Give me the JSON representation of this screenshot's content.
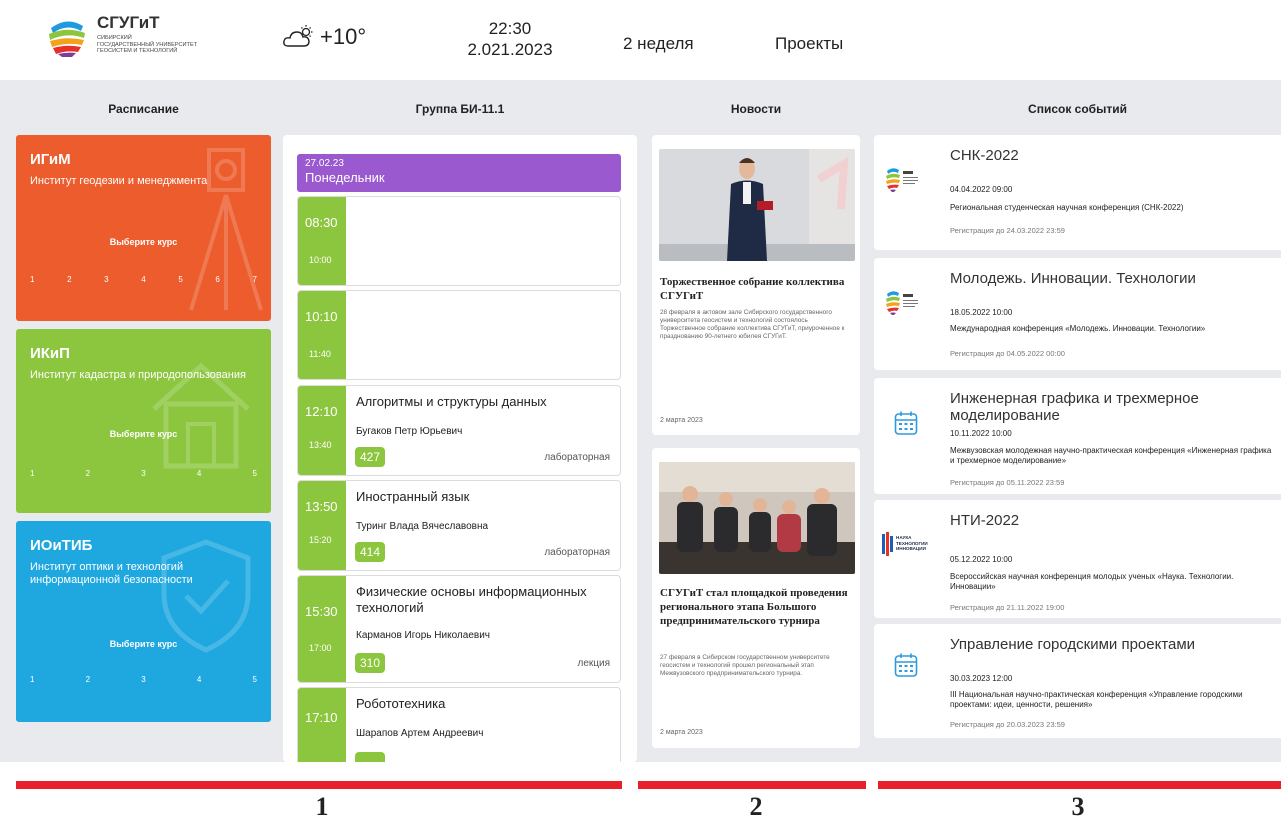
{
  "header": {
    "logo_name": "СГУГиТ",
    "logo_subtitle": "СИБИРСКИЙ\nГОСУДАРСТВЕННЫЙ УНИВЕРСИТЕТ\nГЕОСИСТЕМ И ТЕХНОЛОГИЙ",
    "weather_icon": "cloud-sun-icon",
    "temperature": "+10°",
    "time": "22:30",
    "date": "2.021.2023",
    "week": "2 неделя",
    "projects": "Проекты"
  },
  "columns": {
    "schedule": "Расписание",
    "group": "Группа БИ-11.1",
    "news": "Новости",
    "events": "Список событий"
  },
  "institutes": [
    {
      "abbr": "ИГиМ",
      "name": "Институт геодезии и менеджмента",
      "pick_label": "Выберите курс",
      "courses": [
        "1",
        "2",
        "3",
        "4",
        "5",
        "6",
        "7"
      ],
      "color": "#ec5c2d",
      "icon": "theodolite-icon"
    },
    {
      "abbr": "ИКиП",
      "name": "Институт кадастра и природопользования",
      "pick_label": "Выберите курс",
      "courses": [
        "1",
        "2",
        "3",
        "4",
        "5"
      ],
      "color": "#8cc63f",
      "icon": "house-icon"
    },
    {
      "abbr": "ИОиТИБ",
      "name": "Институт оптики и технологий информационной безопасности",
      "pick_label": "Выберите курс",
      "courses": [
        "1",
        "2",
        "3",
        "4",
        "5"
      ],
      "color": "#1fa8e0",
      "icon": "shield-icon"
    }
  ],
  "schedule": {
    "day_date": "27.02.23",
    "day_name": "Понедельник",
    "day_color": "#9b59d0",
    "slots": [
      {
        "start": "08:30",
        "end": "10:00",
        "subject": "",
        "teacher": "",
        "room": "",
        "kind": ""
      },
      {
        "start": "10:10",
        "end": "11:40",
        "subject": "",
        "teacher": "",
        "room": "",
        "kind": ""
      },
      {
        "start": "12:10",
        "end": "13:40",
        "subject": "Алгоритмы и структуры данных",
        "teacher": "Бугаков Петр Юрьевич",
        "room": "427",
        "kind": "лабораторная"
      },
      {
        "start": "13:50",
        "end": "15:20",
        "subject": "Иностранный язык",
        "teacher": "Туринг Влада Вячеславовна",
        "room": "414",
        "kind": "лабораторная"
      },
      {
        "start": "15:30",
        "end": "17:00",
        "subject": "Физические основы информационных технологий",
        "teacher": "Карманов Игорь Николаевич",
        "room": "310",
        "kind": "лекция"
      },
      {
        "start": "17:10",
        "end": "",
        "subject": "Робототехника",
        "teacher": "Шарапов Артем Андреевич",
        "room": "",
        "kind": ""
      }
    ]
  },
  "news": [
    {
      "title": "Торжественное собрание коллектива СГУГиТ",
      "text": "28 февраля в актовом зале Сибирского государственного университета геосистем и технологий состоялось Торжественное собрание коллектива СГУГиТ, приуроченное к празднованию 90-летнего юбилея СГУГиТ.",
      "date": "2 марта 2023"
    },
    {
      "title": "СГУГиТ стал площадкой проведения регионального этапа Большого предпринимательского турнира",
      "text": "27 февраля в Сибирском государственном университете геосистем и технологий прошел региональный этап Межвузовского предпринимательского турнира.",
      "date": "2 марта 2023"
    }
  ],
  "events": [
    {
      "icon": "sgugit-logo-icon",
      "name": "СНК-2022",
      "datetime": "04.04.2022 09:00",
      "description": "Региональная студенческая научная конференция (СНК-2022)",
      "registration": "Регистрация до 24.03.2022 23:59"
    },
    {
      "icon": "sgugit-logo-icon",
      "name": "Молодежь. Инновации. Технологии",
      "datetime": "18.05.2022 10:00",
      "description": "Международная конференция «Молодежь. Инновации. Технологии»",
      "registration": "Регистрация до 04.05.2022 00:00"
    },
    {
      "icon": "calendar-icon",
      "name": "Инженерная графика и трехмерное моделирование",
      "datetime": "10.11.2022 10:00",
      "description": "Межвузовская молодежная научно-практическая конференция «Инженерная графика и трехмерное моделирование»",
      "registration": "Регистрация до 05.11.2022 23:59"
    },
    {
      "icon": "nti-logo-icon",
      "logo_text": "НАУКА ТЕХНОЛОГИИ ИННОВАЦИИ",
      "name": "НТИ-2022",
      "datetime": "05.12.2022 10:00",
      "description": "Всероссийская научная конференция молодых ученых «Наука. Технологии. Инновации»",
      "registration": "Регистрация до 21.11.2022 19:00"
    },
    {
      "icon": "calendar-icon",
      "name": "Управление городскими проектами",
      "datetime": "30.03.2023 12:00",
      "description": "III Национальная научно-практическая конференция «Управление городскими проектами: идеи, ценности, решения»",
      "registration": "Регистрация до 20.03.2023 23:59"
    }
  ],
  "markers": [
    "1",
    "2",
    "3"
  ],
  "colors": {
    "accent_red": "#e8202a",
    "green": "#8cc63f",
    "board_bg": "#e9eaed"
  }
}
